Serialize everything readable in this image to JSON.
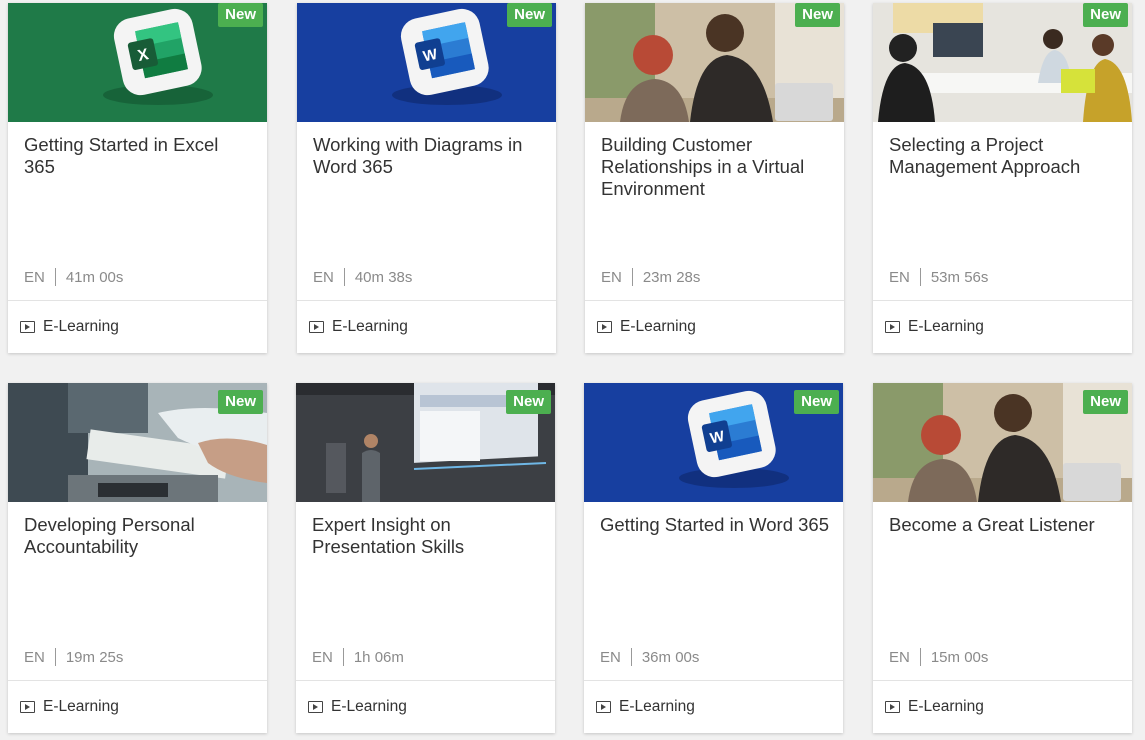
{
  "courses": [
    {
      "title": "Getting Started in Excel 365",
      "badge": "New",
      "language": "EN",
      "duration": "41m 00s",
      "type": "E-Learning",
      "image": "excel-logo-image"
    },
    {
      "title": "Working with Diagrams in Word 365",
      "badge": "New",
      "language": "EN",
      "duration": "40m 38s",
      "type": "E-Learning",
      "image": "word-logo-image"
    },
    {
      "title": "Building Customer Relationships in a Virtual Environment",
      "badge": "New",
      "language": "EN",
      "duration": "23m 28s",
      "type": "E-Learning",
      "image": "people-on-couch-photo"
    },
    {
      "title": "Selecting a Project Management Approach",
      "badge": "New",
      "language": "EN",
      "duration": "53m 56s",
      "type": "E-Learning",
      "image": "office-meeting-photo"
    },
    {
      "title": "Developing Personal Accountability",
      "badge": "New",
      "language": "EN",
      "duration": "19m 25s",
      "type": "E-Learning",
      "image": "laptop-writing-photo"
    },
    {
      "title": "Expert Insight on Presentation Skills",
      "badge": "New",
      "language": "EN",
      "duration": "1h 06m",
      "type": "E-Learning",
      "image": "presenter-photo"
    },
    {
      "title": "Getting Started in Word 365",
      "badge": "New",
      "language": "EN",
      "duration": "36m 00s",
      "type": "E-Learning",
      "image": "word-logo-image"
    },
    {
      "title": "Become a Great Listener",
      "badge": "New",
      "language": "EN",
      "duration": "15m 00s",
      "type": "E-Learning",
      "image": "people-on-couch-photo"
    }
  ],
  "colors": {
    "badge": "#4caf50",
    "excel_green": "#1e7144",
    "word_blue": "#173fa0"
  }
}
